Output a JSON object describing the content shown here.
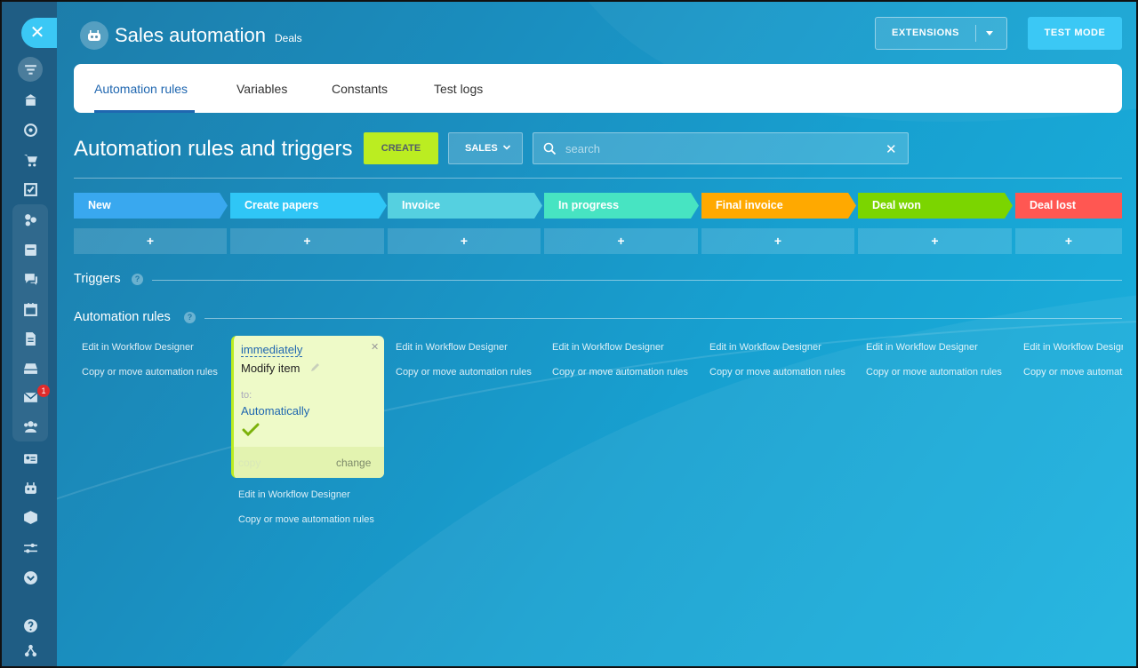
{
  "header": {
    "title": "Sales automation",
    "subtitle": "Deals",
    "extensions_label": "EXTENSIONS",
    "test_mode_label": "TEST MODE"
  },
  "tabs": [
    {
      "label": "Automation rules",
      "active": true
    },
    {
      "label": "Variables",
      "active": false
    },
    {
      "label": "Constants",
      "active": false
    },
    {
      "label": "Test logs",
      "active": false
    }
  ],
  "toolbar": {
    "heading": "Automation rules and triggers",
    "create_label": "CREATE",
    "sales_label": "SALES",
    "search_placeholder": "search",
    "clear_glyph": "✕"
  },
  "stages": [
    {
      "label": "New",
      "color": "#39a8ef"
    },
    {
      "label": "Create papers",
      "color": "#2fc6f6"
    },
    {
      "label": "Invoice",
      "color": "#55d0e0"
    },
    {
      "label": "In progress",
      "color": "#47e4c2"
    },
    {
      "label": "Final invoice",
      "color": "#ffa900"
    },
    {
      "label": "Deal won",
      "color": "#7bd500"
    },
    {
      "label": "Deal lost",
      "color": "#ff5752"
    }
  ],
  "add_glyph": "+",
  "sections": {
    "triggers": "Triggers",
    "automation_rules": "Automation rules",
    "help_glyph": "?"
  },
  "rule_links": {
    "edit": "Edit in Workflow Designer",
    "copy_move": "Copy or move automation rules"
  },
  "robot_card": {
    "when": "immediately",
    "name": "Modify item",
    "to_label": "to:",
    "responsible": "Automatically",
    "copy_label": "copy",
    "change_label": "change",
    "close_glyph": "✕"
  },
  "sidebar": {
    "close_glyph": "✕",
    "mail_badge": "1",
    "icons": [
      "filter-icon",
      "store-icon",
      "target-icon",
      "cart-icon",
      "task-icon",
      "crm-icon",
      "sites-icon",
      "chat-icon",
      "calendar-icon",
      "document-icon",
      "inbox-icon",
      "mail-icon",
      "contacts-icon",
      "contact-card-icon",
      "robot-icon",
      "box-icon",
      "settings-sliders-icon",
      "chevron-down-icon",
      "help-icon",
      "sitemap-icon"
    ]
  },
  "colors": {
    "accent": "#3bc8f5",
    "create": "#bbed21",
    "tab_active": "#2067b0"
  }
}
